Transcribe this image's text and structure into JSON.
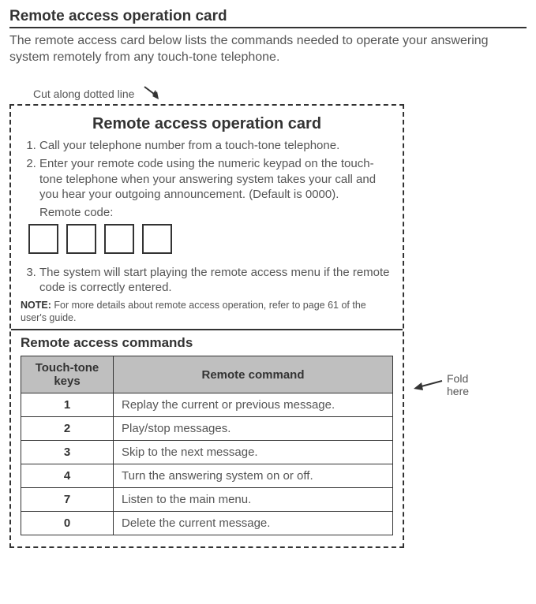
{
  "page_title": "Remote access operation card",
  "intro": "The remote access card below lists the commands needed to operate your answering system remotely from any touch-tone telephone.",
  "cut_label": "Cut along dotted line",
  "fold_label_1": "Fold",
  "fold_label_2": "here",
  "card": {
    "title": "Remote access operation card",
    "steps": [
      "Call your telephone number from a touch-tone telephone.",
      "Enter your remote code using the numeric keypad on the touch-tone telephone when your answering system takes your call and you hear your outgoing announcement. (Default is 0000).",
      "The system will start playing the remote access menu if the remote code is correctly entered."
    ],
    "remote_code_label": "Remote code:",
    "note_prefix": "NOTE:",
    "note_text": " For more details about remote access operation, refer to page 61 of the user's guide.",
    "commands_title": "Remote access commands",
    "table": {
      "head_key": "Touch-tone keys",
      "head_cmd": "Remote command",
      "rows": [
        {
          "key": "1",
          "cmd": "Replay the current or previous message."
        },
        {
          "key": "2",
          "cmd": "Play/stop messages."
        },
        {
          "key": "3",
          "cmd": "Skip to the next message."
        },
        {
          "key": "4",
          "cmd": "Turn the answering system on or off."
        },
        {
          "key": "7",
          "cmd": "Listen to the main menu."
        },
        {
          "key": "0",
          "cmd": "Delete the current message."
        }
      ]
    }
  }
}
